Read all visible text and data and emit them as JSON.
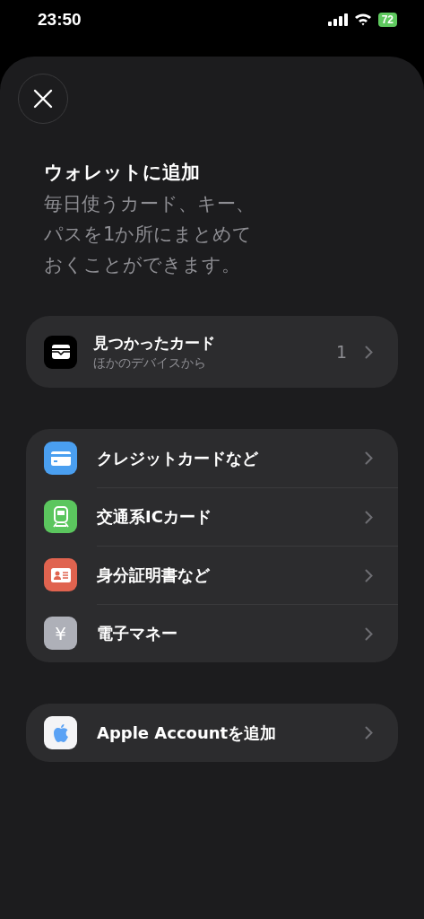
{
  "status_bar": {
    "time": "23:50",
    "battery": "72"
  },
  "sheet": {
    "title": "ウォレットに追加",
    "subtitle": "毎日使うカード、キー、パスを1か所にまとめておくことができます。"
  },
  "groups": [
    {
      "items": [
        {
          "kind": "wallet",
          "label": "見つかったカード",
          "sublabel": "ほかのデバイスから",
          "count": "1"
        }
      ]
    },
    {
      "items": [
        {
          "kind": "credit",
          "label": "クレジットカードなど"
        },
        {
          "kind": "transit",
          "label": "交通系ICカード"
        },
        {
          "kind": "id",
          "label": "身分証明書など"
        },
        {
          "kind": "money",
          "label": "電子マネー",
          "glyph": "¥"
        }
      ]
    },
    {
      "items": [
        {
          "kind": "apple",
          "label": "Apple Accountを追加"
        }
      ]
    }
  ]
}
